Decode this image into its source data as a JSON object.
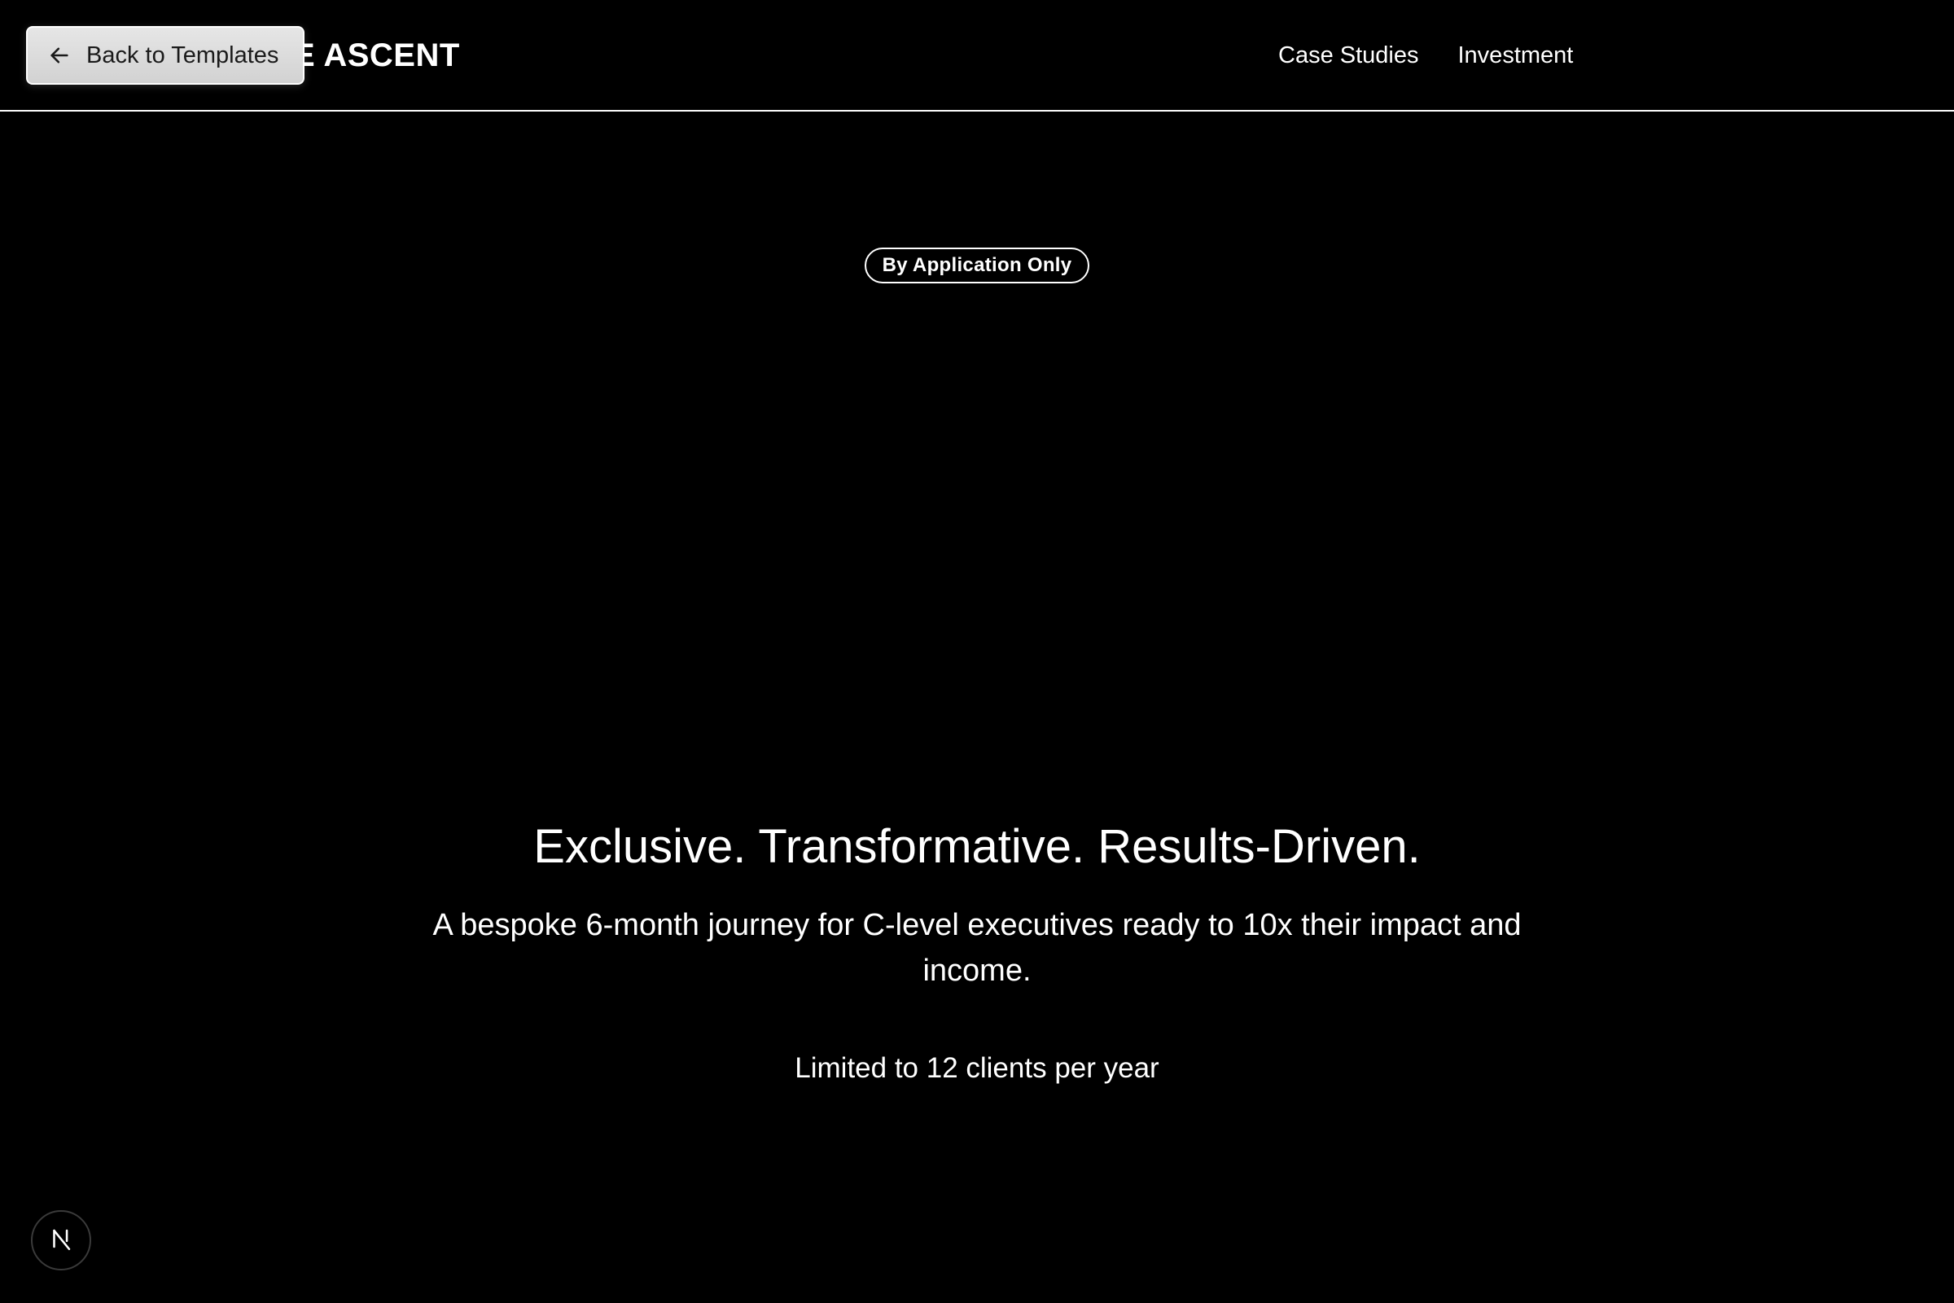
{
  "header": {
    "brand": "EXECUTIVE ASCENT",
    "nav": [
      {
        "label": "Case Studies"
      },
      {
        "label": "Investment"
      }
    ]
  },
  "back_button": {
    "label": "Back to Templates",
    "icon": "arrow-left-icon"
  },
  "badge": {
    "label": "By Application Only"
  },
  "hero": {
    "title": "Exclusive. Transformative. Results-Driven.",
    "subtitle": "A bespoke 6-month journey for C-level executives ready to 10x their impact and income.",
    "note": "Limited to 12 clients per year"
  },
  "dev_indicator": {
    "icon": "nextjs-n-icon"
  },
  "colors": {
    "background": "#000000",
    "text": "#ffffff",
    "button_bg": "#dcdcdc"
  }
}
